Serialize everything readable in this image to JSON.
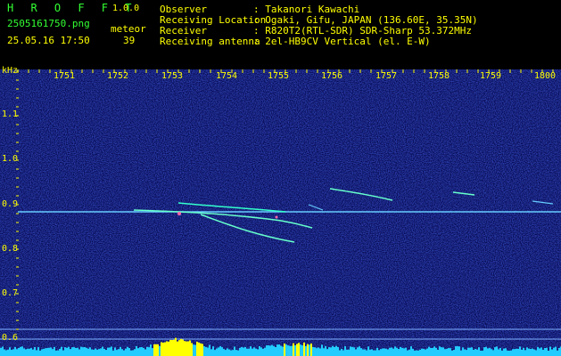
{
  "header": {
    "app_name": "H R O F F T",
    "version": "1.0.0",
    "filename": "2505161750.png",
    "category": "meteor",
    "datetime": "25.05.16 17:50",
    "count": "39",
    "labels": [
      "Observer",
      "Receiving Location",
      "Receiver",
      "Receiving antenna"
    ],
    "values": [
      ": Takanori Kawachi",
      ": Ogaki, Gifu, JAPAN (136.60E, 35.35N)",
      ": R820T2(RTL-SDR) SDR-Sharp 53.372MHz",
      ": 2el-HB9CV Vertical (el. E-W)"
    ]
  },
  "axes": {
    "y_unit": "kHz",
    "y_ticks": [
      "1.1",
      "1.0",
      "0.9",
      "0.8",
      "0.7",
      "0.6"
    ],
    "x_ticks": [
      "1751",
      "1752",
      "1753",
      "1754",
      "1755",
      "1756",
      "1757",
      "1758",
      "1759",
      "1800"
    ]
  },
  "colors": {
    "background": "#0a0a6a",
    "tick_label": "#ffff00",
    "carrier": "#66ccff",
    "echo": "#66ffcc"
  }
}
